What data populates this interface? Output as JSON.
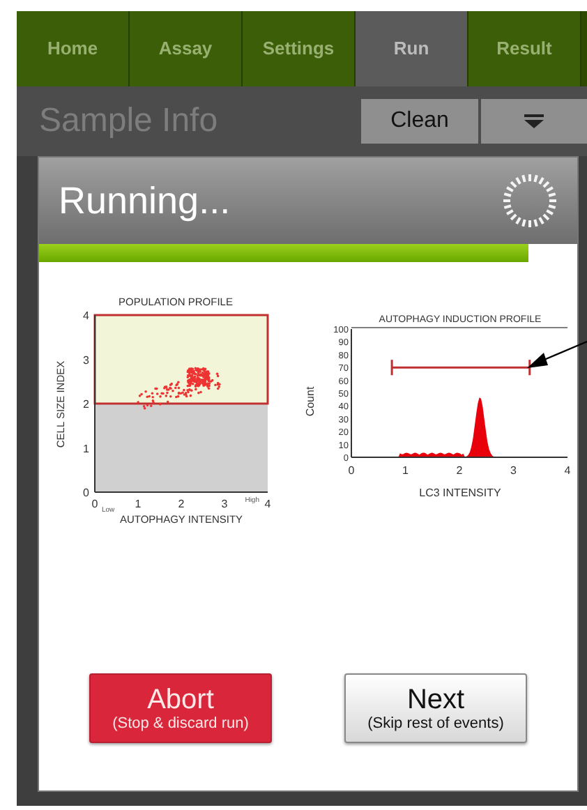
{
  "tabs": [
    {
      "label": "Home",
      "selected": false
    },
    {
      "label": "Assay",
      "selected": false
    },
    {
      "label": "Settings",
      "selected": false
    },
    {
      "label": "Run",
      "selected": true
    },
    {
      "label": "Result",
      "selected": false
    }
  ],
  "page_title": "Sample Info",
  "toolbar": {
    "clean_button": "Clean"
  },
  "dialog": {
    "title": "Running...",
    "progress": {
      "level": 0.91
    },
    "population_profile": {
      "title": "POPULATION PROFILE",
      "ylabel": "CELL SIZE INDEX",
      "xlabel": "AUTOPHAGY INTENSITY",
      "yticks": [
        "4",
        "3",
        "2",
        "1",
        "0"
      ],
      "xticks": [
        "0",
        "1",
        "2",
        "3",
        "4"
      ],
      "x_low": "Low",
      "x_high": "High"
    },
    "induction_profile": {
      "title": "AUTOPHAGY INDUCTION PROFILE",
      "ylabel": "Count",
      "xlabel": "LC3 INTENSITY",
      "yticks": [
        "100",
        "90",
        "80",
        "70",
        "60",
        "50",
        "40",
        "30",
        "20",
        "10",
        "0"
      ],
      "xticks": [
        "0",
        "1",
        "2",
        "3",
        "4"
      ]
    },
    "buttons": [
      {
        "kind": "danger",
        "label": "Abort",
        "sublabel": "(Stop & discard run)"
      },
      {
        "kind": "default",
        "label": "Next",
        "sublabel": "(Skip rest of events)"
      }
    ]
  }
}
